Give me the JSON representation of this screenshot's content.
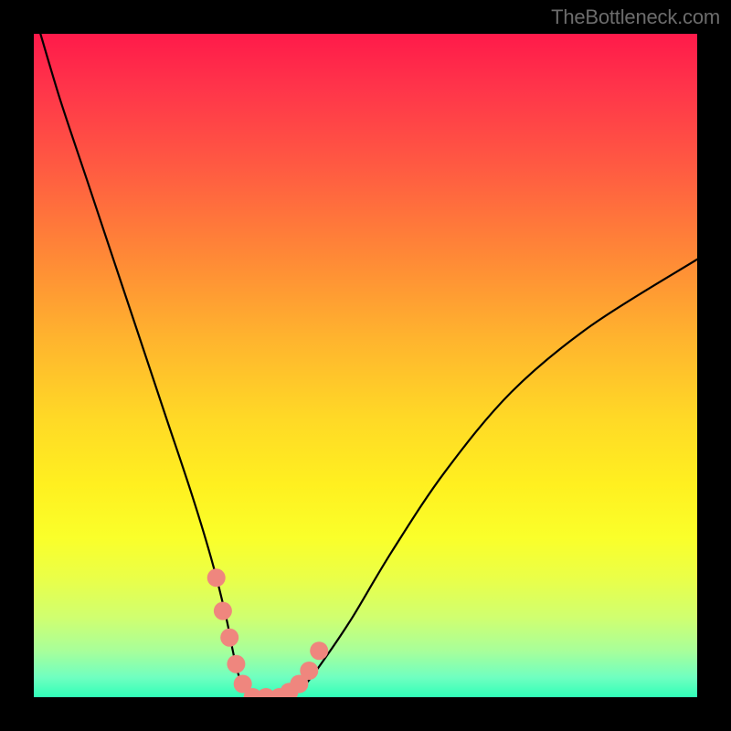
{
  "watermark": "TheBottleneck.com",
  "colors": {
    "background": "#000000",
    "curve_stroke": "#000000",
    "marker_fill": "#ef867e",
    "marker_stroke": "#d06058",
    "gradient_top": "#ff1a4a",
    "gradient_bottom": "#30ffb8"
  },
  "chart_data": {
    "type": "line",
    "title": "",
    "xlabel": "",
    "ylabel": "",
    "xlim": [
      0,
      100
    ],
    "ylim": [
      0,
      100
    ],
    "grid": false,
    "legend": false,
    "series": [
      {
        "name": "bottleneck-curve",
        "x": [
          1,
          4,
          8,
          12,
          16,
          20,
          24,
          27,
          29,
          30,
          31,
          33,
          35,
          37,
          39,
          41,
          44,
          48,
          54,
          62,
          72,
          84,
          100
        ],
        "y": [
          100,
          90,
          78,
          66,
          54,
          42,
          30,
          20,
          12,
          7,
          3,
          0,
          0,
          0,
          0.5,
          2,
          6,
          12,
          22,
          34,
          46,
          56,
          66
        ]
      }
    ],
    "annotations": {
      "salmon_markers_x": [
        27.5,
        28.5,
        29.5,
        30.5,
        31.5,
        33.0,
        35.0,
        37.0,
        38.5,
        40.0,
        41.5,
        43.0
      ],
      "salmon_markers_y": [
        18,
        13,
        9,
        5,
        2,
        0,
        0,
        0,
        0.8,
        2,
        4,
        7
      ]
    }
  }
}
